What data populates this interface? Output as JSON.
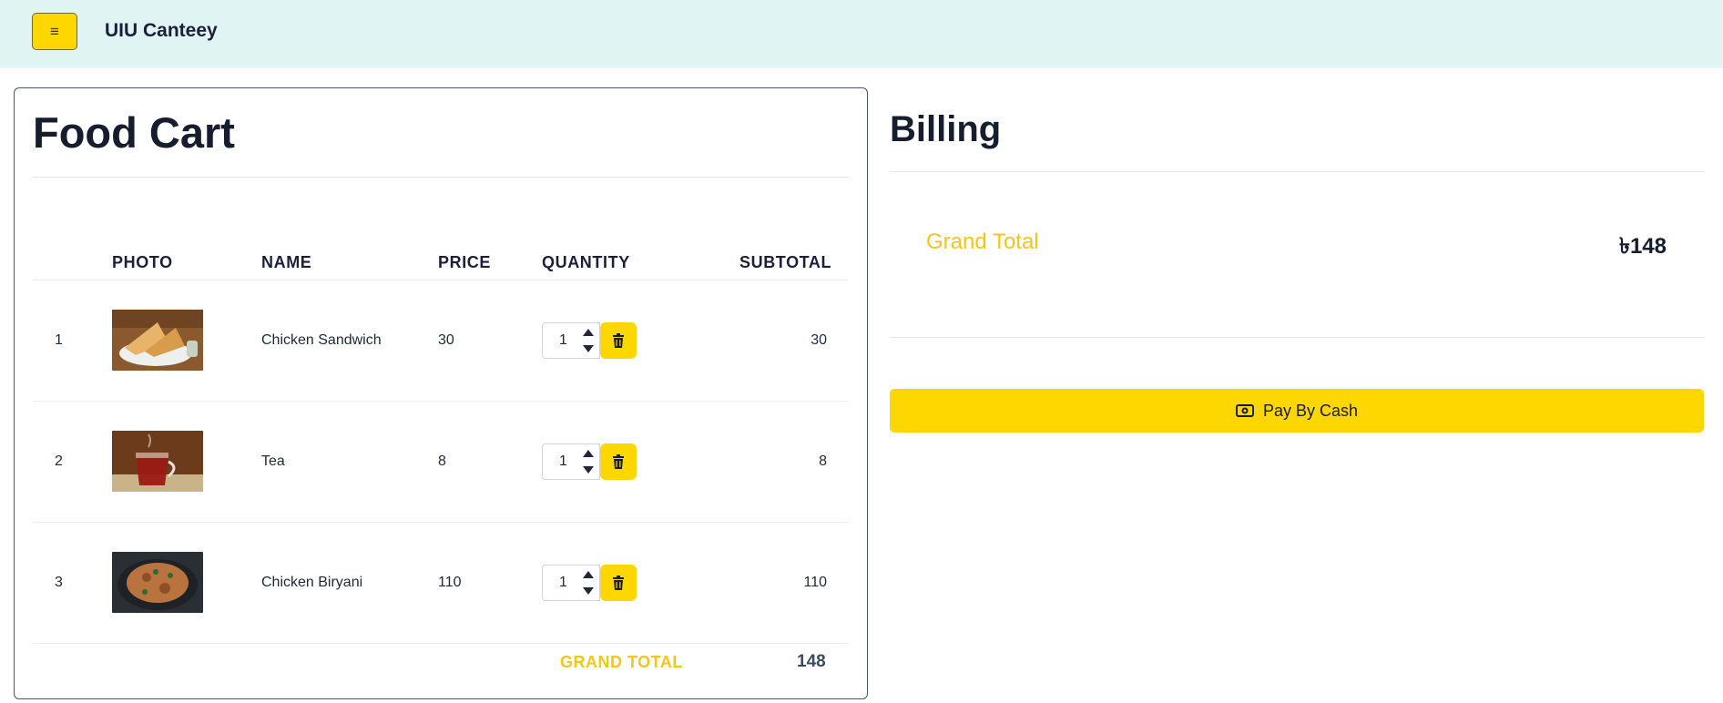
{
  "navbar": {
    "menu_icon": "≡",
    "brand": "UIU Canteey"
  },
  "cart": {
    "title": "Food Cart",
    "columns": [
      "PHOTO",
      "NAME",
      "PRICE",
      "QUANTITY",
      "SUBTOTAL"
    ],
    "rows": [
      {
        "index": "1",
        "photo": "sandwich-photo",
        "name": "Chicken Sandwich",
        "price": "30",
        "quantity": "1",
        "subtotal": "30"
      },
      {
        "index": "2",
        "photo": "tea-photo",
        "name": "Tea",
        "price": "8",
        "quantity": "1",
        "subtotal": "8"
      },
      {
        "index": "3",
        "photo": "biryani-photo",
        "name": "Chicken Biryani",
        "price": "110",
        "quantity": "1",
        "subtotal": "110"
      }
    ],
    "grand_total_label": "GRAND TOTAL",
    "grand_total_value": "148"
  },
  "billing": {
    "title": "Billing",
    "grand_total_label": "Grand Total",
    "grand_total_value": "৳148",
    "pay_button_label": "Pay By Cash",
    "pay_icon": "cash-icon"
  },
  "colors": {
    "accent": "#ffd700",
    "navbar_bg": "#e1f4f4",
    "gold_text": "#f5c518"
  }
}
